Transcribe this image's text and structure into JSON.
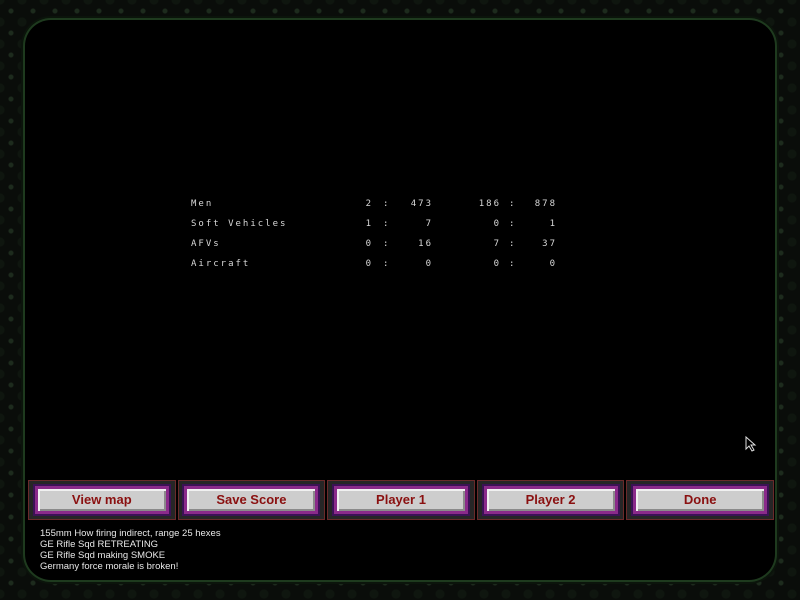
{
  "stats": {
    "rows": [
      {
        "label": "Men",
        "p1_a": "2",
        "p1_b": "473",
        "p2_a": "186",
        "p2_b": "878"
      },
      {
        "label": "Soft Vehicles",
        "p1_a": "1",
        "p1_b": "7",
        "p2_a": "0",
        "p2_b": "1"
      },
      {
        "label": "AFVs",
        "p1_a": "0",
        "p1_b": "16",
        "p2_a": "7",
        "p2_b": "37"
      },
      {
        "label": "Aircraft",
        "p1_a": "0",
        "p1_b": "0",
        "p2_a": "0",
        "p2_b": "0"
      }
    ],
    "separator": ":"
  },
  "buttons": {
    "view_map": "View map",
    "save_score": "Save Score",
    "player1": "Player 1",
    "player2": "Player 2",
    "done": "Done"
  },
  "messages": [
    "155mm How firing indirect, range 25 hexes",
    "GE Rifle Sqd RETREATING",
    "GE Rifle Sqd making SMOKE",
    "Germany force morale is broken!"
  ],
  "colors": {
    "button_text": "#8a1010",
    "button_border": "#8a2a8a",
    "frame_accent": "#1e3a1e"
  },
  "icons": {
    "cursor": "mouse-pointer-icon"
  }
}
